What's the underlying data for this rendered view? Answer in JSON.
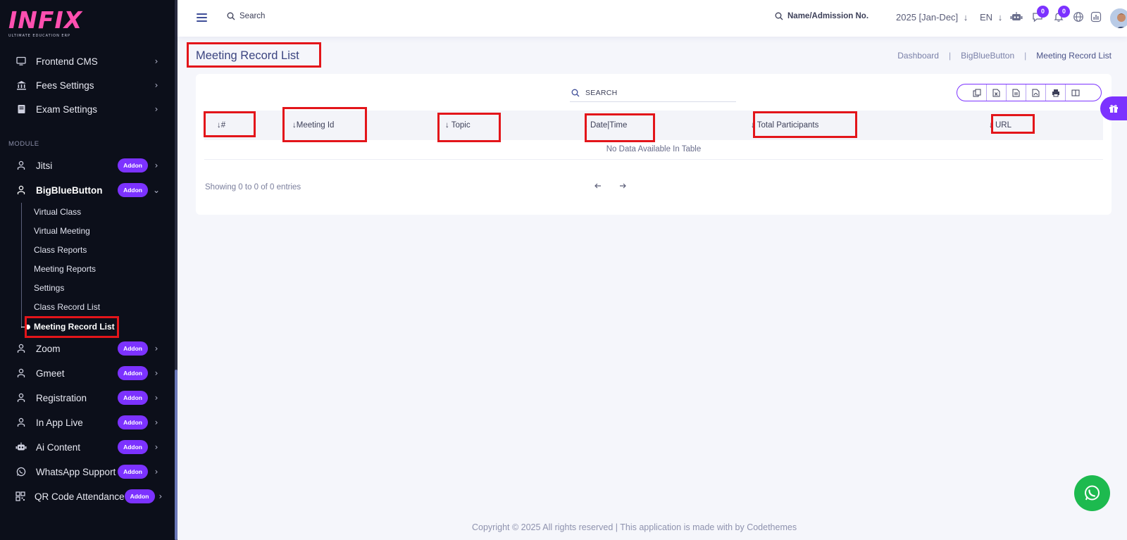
{
  "brand": {
    "logo": "INFIX",
    "tagline": "ULTIMATE EDUCATION ERP"
  },
  "sidebar": {
    "top_items": [
      {
        "label": "Frontend CMS",
        "icon": "monitor-icon"
      },
      {
        "label": "Fees Settings",
        "icon": "bank-icon"
      },
      {
        "label": "Exam Settings",
        "icon": "book-icon"
      }
    ],
    "module_title": "MODULE",
    "modules": [
      {
        "label": "Jitsi",
        "badge": "Addon",
        "icon": "video-person-icon"
      },
      {
        "label": "BigBlueButton",
        "badge": "Addon",
        "icon": "video-person-icon",
        "expanded": true
      },
      {
        "label": "Zoom",
        "badge": "Addon",
        "icon": "video-person-icon"
      },
      {
        "label": "Gmeet",
        "badge": "Addon",
        "icon": "video-person-icon"
      },
      {
        "label": "Registration",
        "badge": "Addon",
        "icon": "video-person-icon"
      },
      {
        "label": "In App Live",
        "badge": "Addon",
        "icon": "video-person-icon"
      },
      {
        "label": "Ai Content",
        "badge": "Addon",
        "icon": "robot-icon"
      },
      {
        "label": "WhatsApp Support",
        "badge": "Addon",
        "icon": "whatsapp-icon"
      },
      {
        "label": "QR Code Attendance",
        "badge": "Addon",
        "icon": "qr-code-icon"
      }
    ],
    "submenu": [
      {
        "label": "Virtual Class"
      },
      {
        "label": "Virtual Meeting"
      },
      {
        "label": "Class Reports"
      },
      {
        "label": "Meeting Reports"
      },
      {
        "label": "Settings"
      },
      {
        "label": "Class Record List"
      },
      {
        "label": "Meeting Record List",
        "active": true
      }
    ]
  },
  "header": {
    "search_label": "Search",
    "name_search_label": "Name/Admission No.",
    "academic_year": "2025 [Jan-Dec]",
    "language": "EN",
    "message_count": "0",
    "notification_count": "0"
  },
  "page": {
    "title": "Meeting Record List",
    "breadcrumb": [
      "Dashboard",
      "BigBlueButton",
      "Meeting Record List"
    ]
  },
  "table": {
    "search_placeholder": "SEARCH",
    "columns": [
      "#",
      "Meeting Id",
      "Topic",
      "Date|Time",
      "Total Participants",
      "URL"
    ],
    "empty_message": "No Data Available In Table",
    "info": "Showing 0 to 0 of 0 entries",
    "export_buttons": [
      "copy-icon",
      "excel-icon",
      "csv-icon",
      "pdf-icon",
      "print-icon",
      "columns-icon"
    ]
  },
  "footer": {
    "text": "Copyright © 2025 All rights reserved | This application is made with by Codethemes"
  },
  "colors": {
    "accent": "#7c32ff",
    "sidebar_bg": "#0c0f1a",
    "highlight_red": "#e3151a",
    "whatsapp_green": "#1dba4f"
  }
}
